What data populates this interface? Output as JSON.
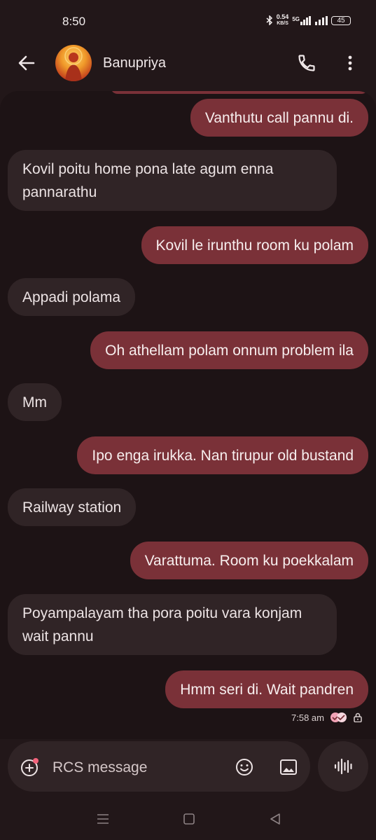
{
  "status_bar": {
    "time": "8:50",
    "net_speed_value": "0.54",
    "net_speed_unit": "KB/S",
    "network": "5G",
    "battery": "45"
  },
  "header": {
    "contact_name": "Banupriya",
    "back_icon": "arrow-back-icon",
    "call_icon": "phone-icon",
    "menu_icon": "more-vert-icon"
  },
  "messages": [
    {
      "direction": "outgoing",
      "text": "Vanthutu call pannu di."
    },
    {
      "direction": "incoming",
      "text": "Kovil poitu home pona late agum enna pannarathu"
    },
    {
      "direction": "outgoing",
      "text": "Kovil le irunthu room ku polam"
    },
    {
      "direction": "incoming",
      "text": "Appadi polama"
    },
    {
      "direction": "outgoing",
      "text": "Oh athellam polam onnum problem ila"
    },
    {
      "direction": "incoming",
      "text": "Mm"
    },
    {
      "direction": "outgoing",
      "text": "Ipo enga irukka. Nan tirupur old bustand"
    },
    {
      "direction": "incoming",
      "text": "Railway station"
    },
    {
      "direction": "outgoing",
      "text": "Varattuma.   Room ku poekkalam"
    },
    {
      "direction": "incoming",
      "text": "Poyampalayam tha  pora poitu vara konjam wait pannu"
    },
    {
      "direction": "outgoing",
      "text": "Hmm seri di. Wait pandren"
    }
  ],
  "last_message_meta": {
    "time": "7:58 am",
    "status_icon": "read-receipt-icon",
    "encryption_icon": "lock-icon"
  },
  "composer": {
    "placeholder": "RCS message",
    "value": ""
  },
  "colors": {
    "background": "#1d1315",
    "incoming_bubble": "#302426",
    "outgoing_bubble": "#7a3138"
  }
}
